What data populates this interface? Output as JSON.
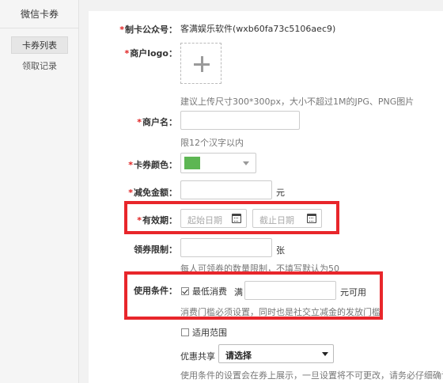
{
  "sidebar": {
    "title": "微信卡券",
    "items": [
      {
        "label": "卡券列表",
        "active": true
      },
      {
        "label": "领取记录",
        "active": false
      }
    ]
  },
  "form": {
    "required_mark": "*",
    "account": {
      "label": "制卡公众号：",
      "value": "客满娱乐软件(wxb60fa73c5106aec9)"
    },
    "logo": {
      "label": "商户logo：",
      "hint": "建议上传尺寸300*300px，大小不超过1M的JPG、PNG图片"
    },
    "merchant_name": {
      "label": "商户名：",
      "value": "",
      "hint": "限12个汉字以内"
    },
    "card_color": {
      "label": "卡券颜色：",
      "value_color": "#5db653"
    },
    "discount": {
      "label": "减免金额：",
      "value": "",
      "unit": "元"
    },
    "validity": {
      "label": "有效期：",
      "start_placeholder": "起始日期",
      "end_placeholder": "截止日期"
    },
    "limit": {
      "label": "领券限制：",
      "value": "",
      "unit": "张",
      "hint": "每人可领券的数量限制，不填写默认为50"
    },
    "condition": {
      "label": "使用条件：",
      "min_spend_label": "最低消费",
      "min_spend_checked": true,
      "full_label": "满",
      "value": "",
      "suffix": "元可用",
      "hint": "消费门槛必须设置，同时也是社交立减金的发放门槛"
    },
    "scope": {
      "label": "适用范围",
      "checked": false
    },
    "share": {
      "label": "优惠共享",
      "selected": "请选择",
      "hint": "使用条件的设置会在券上展示，一旦设置将不可更改，请务必仔细确认。"
    }
  },
  "highlight_color": "#e8262b"
}
